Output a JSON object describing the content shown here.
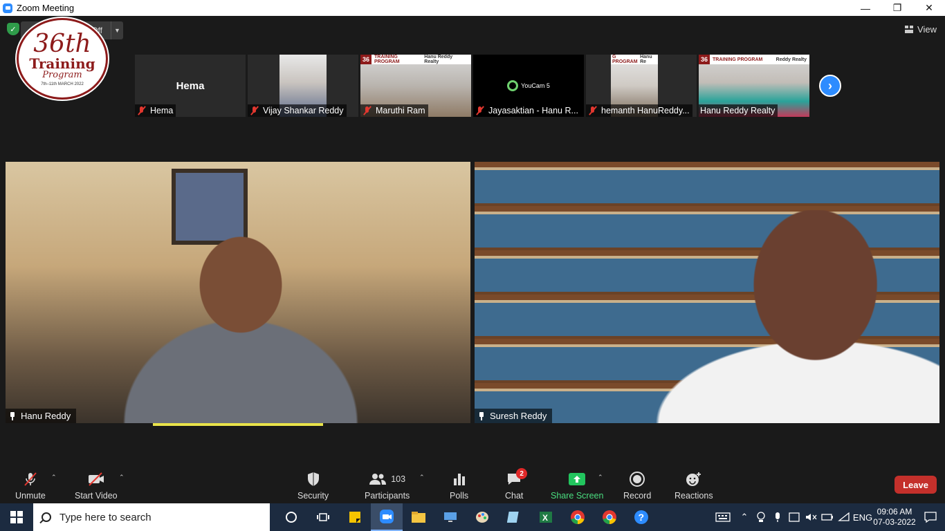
{
  "window": {
    "title": "Zoom Meeting",
    "minimize": "—",
    "restore": "❐",
    "close": "✕"
  },
  "top": {
    "recording_partial": "Off",
    "view_label": "View"
  },
  "logo": {
    "number": "36th",
    "line2": "Training",
    "line3": "Program",
    "line4": "7th–11th MARCH 2022"
  },
  "thumbnails": [
    {
      "name": "Hema",
      "center": "Hema"
    },
    {
      "name": "Vijay Shankar Reddy"
    },
    {
      "name": "Maruthi Ram",
      "banner_left": "36",
      "banner_mid": "TRAINING PROGRAM",
      "banner_right": "Hanu Reddy Realty"
    },
    {
      "name": "Jayasaktian - Hanu R...",
      "center": "YouCam 5"
    },
    {
      "name": "hemanth HanuReddy...",
      "banner_mid": "G PROGRAM",
      "banner_right": "Hanu Re"
    },
    {
      "name": "Hanu Reddy Realty",
      "banner_left": "36",
      "banner_mid": "TRAINING PROGRAM",
      "banner_right": "Reddy Realty"
    }
  ],
  "main_videos": [
    {
      "name": "Hanu Reddy"
    },
    {
      "name": "Suresh Reddy"
    }
  ],
  "toolbar": {
    "unmute": "Unmute",
    "start_video": "Start Video",
    "security": "Security",
    "participants": "Participants",
    "participants_count": "103",
    "polls": "Polls",
    "chat": "Chat",
    "chat_badge": "2",
    "share_screen": "Share Screen",
    "record": "Record",
    "reactions": "Reactions",
    "leave": "Leave"
  },
  "taskbar": {
    "search_placeholder": "Type here to search",
    "language": "ENG",
    "time": "09:06 AM",
    "date": "07-03-2022"
  },
  "colors": {
    "accent": "#2d8cff",
    "leave": "#c4302b",
    "share": "#22c55e",
    "taskbar": "#1c2b40"
  }
}
